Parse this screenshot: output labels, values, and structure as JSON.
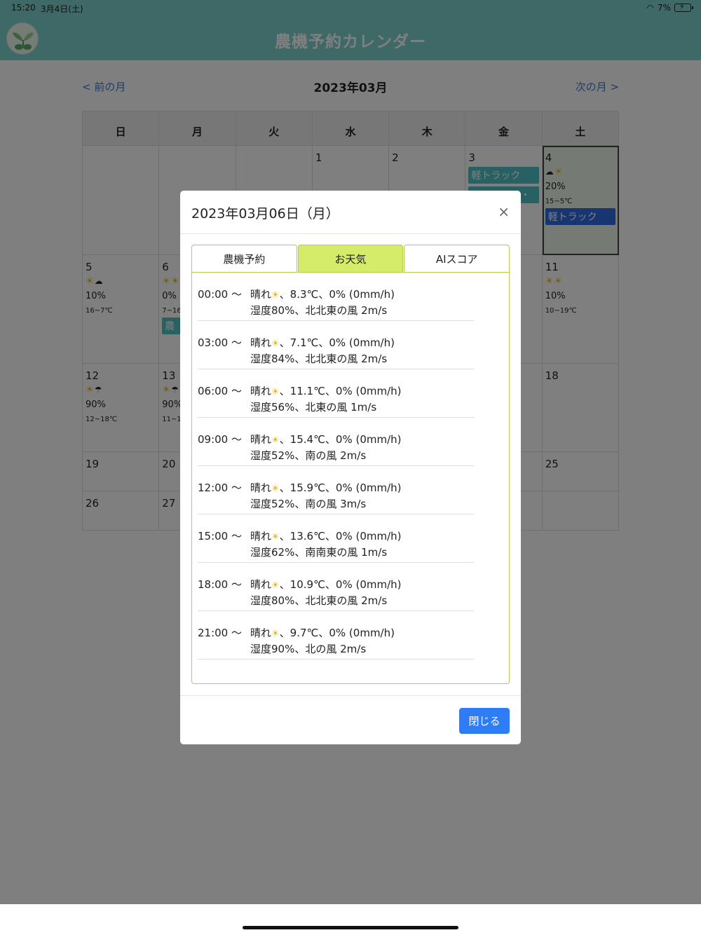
{
  "status": {
    "time": "15:20",
    "date": "3月4日(土)",
    "battery": "7%"
  },
  "header": {
    "title": "農機予約カレンダー"
  },
  "nav": {
    "prev": "< 前の月",
    "current": "2023年03月",
    "next": "次の月 >"
  },
  "calendar": {
    "weekdays": [
      "日",
      "月",
      "火",
      "水",
      "木",
      "金",
      "土"
    ],
    "cells": {
      "d1": "1",
      "d2": "2",
      "d3": "3",
      "d4": "4",
      "d5": "5",
      "d6": "6",
      "d11": "11",
      "d12": "12",
      "d13": "13",
      "d18": "18",
      "d19": "19",
      "d20": "20",
      "d25": "25",
      "d26": "26",
      "d27": "27"
    },
    "d3_event": "軽トラック",
    "d3_event2": "・・・・・・",
    "d4_pop": "20%",
    "d4_temp": "15~5℃",
    "d4_event": "軽トラック",
    "d5_pop": "10%",
    "d5_temp": "16~7℃",
    "d6_pop": "0%",
    "d6_temp": "7~16℃",
    "d6_event": "農",
    "d11_pop": "10%",
    "d11_temp": "10~19℃",
    "d12_pop": "90%",
    "d12_temp": "12~18℃",
    "d13_pop": "90%",
    "d13_temp": "11~1"
  },
  "modal": {
    "title": "2023年03月06日（月）",
    "close_icon": "×",
    "tabs": [
      "農機予約",
      "お天気",
      "AIスコア"
    ],
    "active_tab": 1,
    "weather": [
      {
        "time": "00:00 〜",
        "line1a": "晴れ",
        "line1b": "、8.3℃、0% (0mm/h)",
        "line2": "湿度80%、北北東の風 2m/s"
      },
      {
        "time": "03:00 〜",
        "line1a": "晴れ",
        "line1b": "、7.1℃、0% (0mm/h)",
        "line2": "湿度84%、北北東の風 2m/s"
      },
      {
        "time": "06:00 〜",
        "line1a": "晴れ",
        "line1b": "、11.1℃、0% (0mm/h)",
        "line2": "湿度56%、北東の風 1m/s"
      },
      {
        "time": "09:00 〜",
        "line1a": "晴れ",
        "line1b": "、15.4℃、0% (0mm/h)",
        "line2": "湿度52%、南の風 2m/s"
      },
      {
        "time": "12:00 〜",
        "line1a": "晴れ",
        "line1b": "、15.9℃、0% (0mm/h)",
        "line2": "湿度52%、南の風 3m/s"
      },
      {
        "time": "15:00 〜",
        "line1a": "晴れ",
        "line1b": "、13.6℃、0% (0mm/h)",
        "line2": "湿度62%、南南東の風 1m/s"
      },
      {
        "time": "18:00 〜",
        "line1a": "晴れ",
        "line1b": "、10.9℃、0% (0mm/h)",
        "line2": "湿度80%、北北東の風 2m/s"
      },
      {
        "time": "21:00 〜",
        "line1a": "晴れ",
        "line1b": "、9.7℃、0% (0mm/h)",
        "line2": "湿度90%、北の風 2m/s"
      }
    ],
    "close_button": "閉じる"
  },
  "icons": {
    "sun": "sun-icon",
    "cloud": "cloud-icon",
    "umbrella": "umbrella-icon"
  },
  "colors": {
    "header": "#7cd3cf",
    "tab_active": "#d4ec6a",
    "tab_border": "#b8c84a",
    "button": "#2f7df6",
    "event_teal": "#4fc3c6",
    "event_blue": "#2f6be0"
  }
}
